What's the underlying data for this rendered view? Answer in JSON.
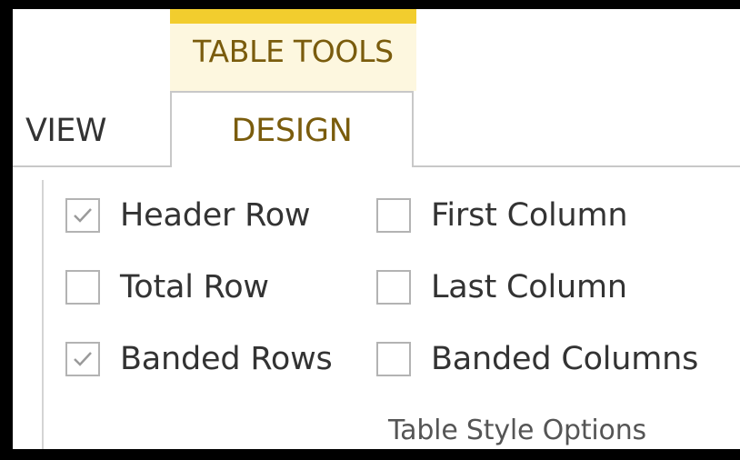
{
  "contextual_tab": {
    "label": "TABLE TOOLS"
  },
  "tabs": {
    "view": "VIEW",
    "design": "DESIGN"
  },
  "options_col1": [
    {
      "label": "Header Row",
      "checked": true
    },
    {
      "label": "Total Row",
      "checked": false
    },
    {
      "label": "Banded Rows",
      "checked": true
    }
  ],
  "options_col2": [
    {
      "label": "First Column",
      "checked": false
    },
    {
      "label": "Last Column",
      "checked": false
    },
    {
      "label": "Banded Columns",
      "checked": false
    }
  ],
  "group": {
    "name": "Table Style Options"
  },
  "colors": {
    "accent": "#f2cd2e",
    "accent_text": "#7a5c0d"
  }
}
